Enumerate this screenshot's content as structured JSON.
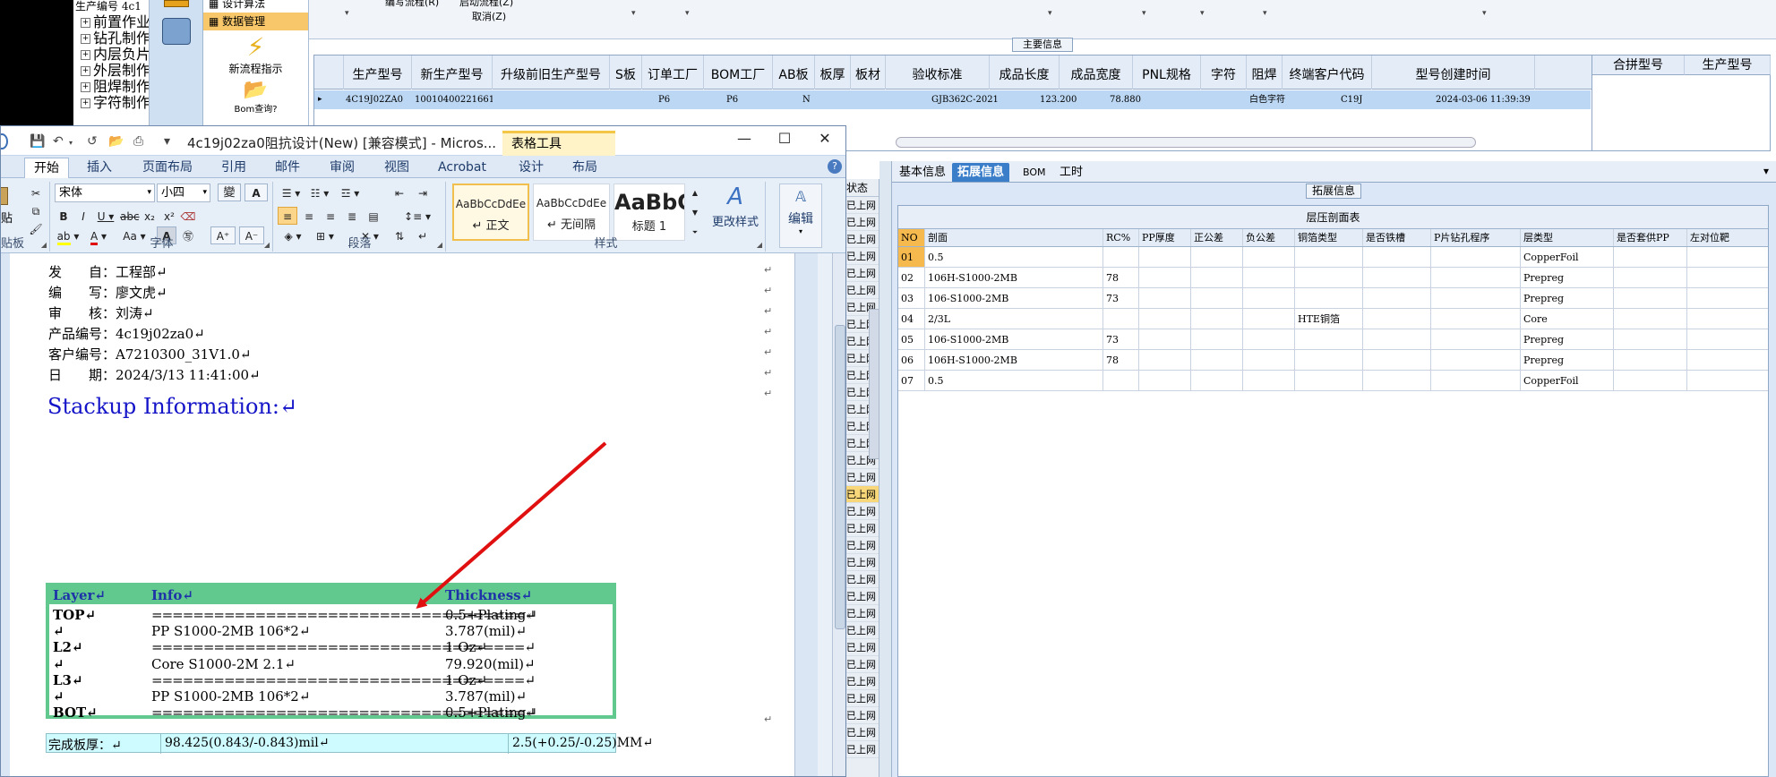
{
  "erp": {
    "tree_header": "生产编号",
    "tree_header_value": "4c1",
    "tree_items": [
      "前置作业",
      "钻孔制作",
      "内层负片",
      "外层制作",
      "阻焊制作",
      "字符制作"
    ],
    "menu": {
      "item_design_algo": "设计算法",
      "item_data_mgmt": "数据管理",
      "new_flow_label": "新流程指示",
      "bom_query_label": "Bom查询?"
    },
    "top_toolbar": {
      "write_flow": "编写流程(R)",
      "start_flow": "启动流程(Z)",
      "cancel": "取消(Z)"
    },
    "main_info_title": "主要信息",
    "main_columns": [
      "生产型号",
      "新生产型号",
      "升级前旧生产型号",
      "S板",
      "订单工厂",
      "BOM工厂",
      "AB板",
      "板厚",
      "板材",
      "验收标准",
      "成品长度",
      "成品宽度",
      "PNL规格",
      "字符",
      "阻焊",
      "终端客户代码",
      "型号创建时间"
    ],
    "main_row": [
      "4C19J02ZA0",
      "10010400221661",
      "",
      "",
      "P6",
      "P6",
      "N",
      "",
      "",
      "GJB362C-2021",
      "123.200",
      "78.880",
      "",
      "白色字符",
      "",
      "C19J",
      "2024-03-06 11:39:39"
    ],
    "merge_columns": [
      "合拼型号",
      "生产型号"
    ],
    "status_header": "状态",
    "status_rows": [
      "已上网",
      "已上网",
      "已上网",
      "已上网",
      "已上网",
      "已上网",
      "已上网",
      "已上网",
      "已上网",
      "已上网",
      "已上网",
      "已上网",
      "已上网",
      "已上网",
      "已上网",
      "已上网",
      "已上网",
      "已上网",
      "已上网",
      "已上网",
      "已上网",
      "已上网",
      "已上网",
      "已上网",
      "已上网",
      "已上网",
      "已上网",
      "已上网",
      "已上网",
      "已上网",
      "已上网",
      "已上网",
      "已上网"
    ],
    "bottom_tabs": [
      "基本信息",
      "拓展信息",
      "BOM",
      "工时"
    ],
    "ext_title": "拓展信息",
    "stack_table_title": "层压剖面表",
    "stack_columns": [
      "NO",
      "剖面",
      "RC%",
      "PP厚度",
      "正公差",
      "负公差",
      "铜箔类型",
      "是否铁槽",
      "P片钻孔程序",
      "层类型",
      "是否套供PP",
      "左对位靶"
    ],
    "stack_rows": [
      [
        "01",
        "0.5",
        "",
        "",
        "",
        "",
        "",
        "",
        "",
        "CopperFoil",
        "",
        ""
      ],
      [
        "02",
        "106H-S1000-2MB",
        "78",
        "",
        "",
        "",
        "",
        "",
        "",
        "Prepreg",
        "",
        ""
      ],
      [
        "03",
        "106-S1000-2MB",
        "73",
        "",
        "",
        "",
        "",
        "",
        "",
        "Prepreg",
        "",
        ""
      ],
      [
        "04",
        "2/3L",
        "",
        "",
        "",
        "",
        "HTE铜箔",
        "",
        "",
        "Core",
        "",
        ""
      ],
      [
        "05",
        "106-S1000-2MB",
        "73",
        "",
        "",
        "",
        "",
        "",
        "",
        "Prepreg",
        "",
        ""
      ],
      [
        "06",
        "106H-S1000-2MB",
        "78",
        "",
        "",
        "",
        "",
        "",
        "",
        "Prepreg",
        "",
        ""
      ],
      [
        "07",
        "0.5",
        "",
        "",
        "",
        "",
        "",
        "",
        "",
        "CopperFoil",
        "",
        ""
      ]
    ]
  },
  "word": {
    "title": "4c19j02za0阻抗设计(New) [兼容模式] - Micros...",
    "context_tab": "表格工具",
    "ribbon_tabs": [
      "开始",
      "插入",
      "页面布局",
      "引用",
      "邮件",
      "审阅",
      "视图",
      "Acrobat",
      "设计",
      "布局"
    ],
    "font_name": "宋体",
    "font_size": "小四",
    "group_clipboard": "贴板",
    "clipboard_paste": "贴",
    "group_font": "字体",
    "group_paragraph": "段落",
    "group_styles": "样式",
    "styles": [
      {
        "preview": "AaBbCcDdEe",
        "name": "↵ 正文"
      },
      {
        "preview": "AaBbCcDdEe",
        "name": "↵ 无间隔"
      },
      {
        "preview": "AaBbC",
        "name": "标题 1"
      }
    ],
    "change_styles": "更改样式",
    "edit_label": "编辑",
    "doc": {
      "meta": [
        "发　　自：工程部↵",
        "编　　写：廖文虎↵",
        "审　　核：刘涛↵",
        "产品编号：4c19j02za0↵",
        "客户编号：A7210300_31V1.0↵",
        "日　　期：2024/3/13 11:41:00↵"
      ],
      "heading": "Stackup Information:↵",
      "table_headers": [
        "Layer↵",
        "Info↵",
        "Thickness↵"
      ],
      "rows": [
        {
          "layer": "TOP↵",
          "info": "====================================↵",
          "thickness": "0.5+Plating↵"
        },
        {
          "layer": "↵",
          "info": "PP     S1000-2MB    106*2↵",
          "thickness": "3.787(mil)↵"
        },
        {
          "layer": "L2↵",
          "info": "====================================↵",
          "thickness": "1 Oz↵"
        },
        {
          "layer": "↵",
          "info": "Core     S1000-2M    2.1↵",
          "thickness": "79.920(mil)↵"
        },
        {
          "layer": "L3↵",
          "info": "====================================↵",
          "thickness": "1 Oz↵"
        },
        {
          "layer": "↵",
          "info": "PP     S1000-2MB    106*2↵",
          "thickness": "3.787(mil)↵"
        },
        {
          "layer": "BOT↵",
          "info": "====================================↵",
          "thickness": "0.5+Plating↵"
        }
      ],
      "total_label": "完成板厚：↵",
      "total_value": "98.425(0.843/-0.843)mil↵",
      "total_mm": "2.5(+0.25/-0.25)MM↵"
    }
  },
  "colors": {
    "accent_tab": "#3a7dc9",
    "table_green": "#62c98e",
    "heading_blue": "#1414c8",
    "arrow_red": "#e01010",
    "highlight_orange": "#f5b94d"
  }
}
